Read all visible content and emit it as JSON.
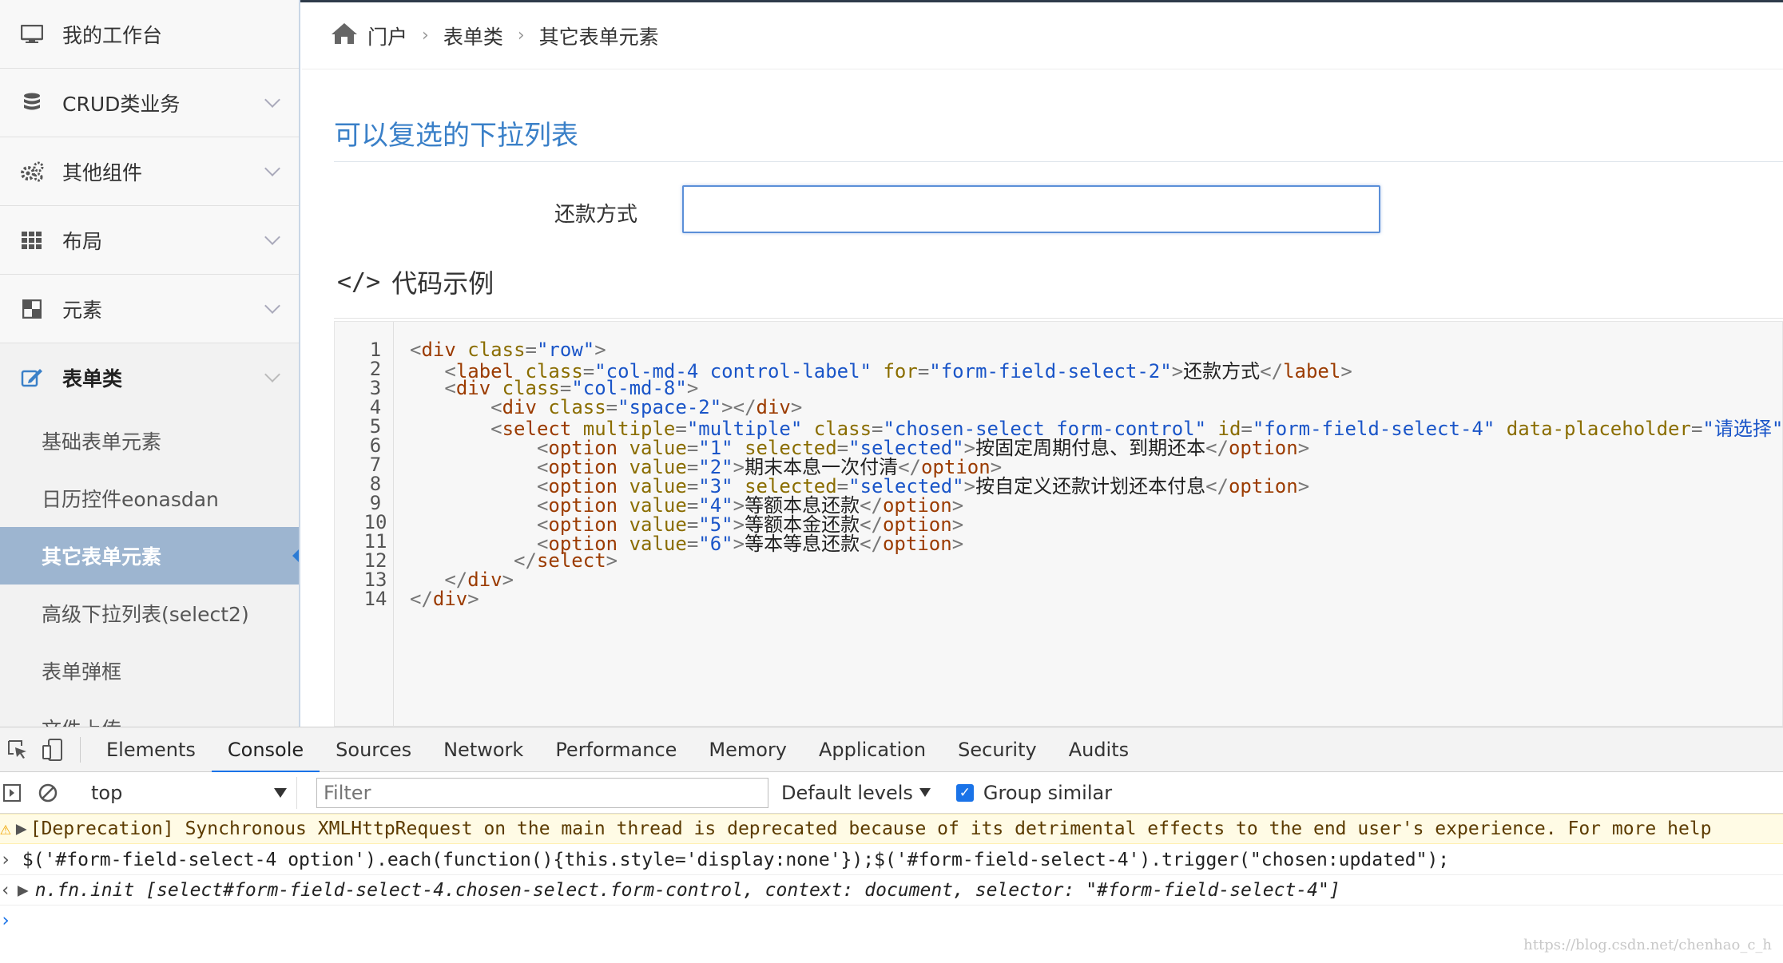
{
  "sidebar": {
    "items": [
      {
        "label": "我的工作台",
        "icon": "monitor-icon",
        "expandable": false
      },
      {
        "label": "CRUD类业务",
        "icon": "database-icon",
        "expandable": true
      },
      {
        "label": "其他组件",
        "icon": "gears-icon",
        "expandable": true
      },
      {
        "label": "布局",
        "icon": "grid-icon",
        "expandable": true
      },
      {
        "label": "元素",
        "icon": "blocks-icon",
        "expandable": true
      },
      {
        "label": "表单类",
        "icon": "edit-icon",
        "expandable": true,
        "open": true
      }
    ],
    "sub_items": [
      {
        "label": "基础表单元素"
      },
      {
        "label": "日历控件eonasdan"
      },
      {
        "label": "其它表单元素",
        "active": true
      },
      {
        "label": "高级下拉列表(select2)"
      },
      {
        "label": "表单弹框"
      },
      {
        "label": "文件上传"
      }
    ]
  },
  "breadcrumb": {
    "home_icon": "home-icon",
    "items": [
      "门户",
      "表单类",
      "其它表单元素"
    ]
  },
  "main": {
    "title": "可以复选的下拉列表",
    "field_label": "还款方式",
    "field_value": "",
    "code_section_tag": "</>",
    "code_section_title": "代码示例"
  },
  "code_lines": [
    "1",
    "2",
    "3",
    "4",
    "5",
    "6",
    "7",
    "8",
    "9",
    "10",
    "11",
    "12",
    "13",
    "14"
  ],
  "devtools": {
    "tabs": [
      "Elements",
      "Console",
      "Sources",
      "Network",
      "Performance",
      "Memory",
      "Application",
      "Security",
      "Audits"
    ],
    "active_tab": "Console",
    "context": "top",
    "filter_placeholder": "Filter",
    "levels": "Default levels",
    "group_similar": "Group similar",
    "group_similar_checked": true,
    "messages": {
      "warning": "[Deprecation] Synchronous XMLHttpRequest on the main thread is deprecated because of its detrimental effects to the end user's experience. For more help",
      "command": "$('#form-field-select-4 option').each(function(){this.style='display:none'});$('#form-field-select-4').trigger(\"chosen:updated\");",
      "result": "n.fn.init [select#form-field-select-4.chosen-select.form-control, context: document, selector: \"#form-field-select-4\"]"
    }
  },
  "watermark": "https://blog.csdn.net/chenhao_c_h",
  "colors": {
    "accent": "#3a80c8",
    "active_menu": "#9db5d0",
    "devtools_active": "#1a73e8",
    "warning_bg": "#fffbe5"
  }
}
